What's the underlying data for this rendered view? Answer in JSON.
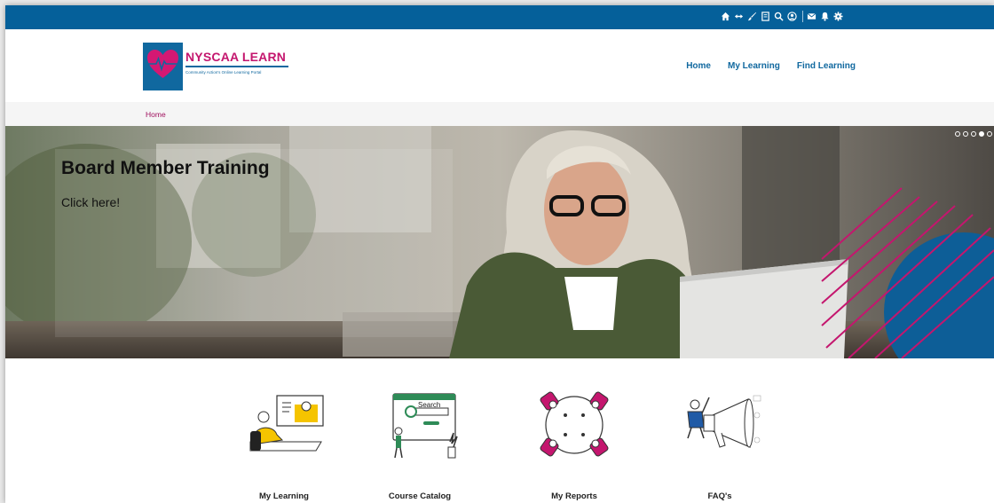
{
  "topbar": {
    "icons": [
      "home-icon",
      "expand-arrows-icon",
      "brush-icon",
      "book-icon",
      "search-icon",
      "user-circle-icon",
      "envelope-icon",
      "bell-icon",
      "gear-icon"
    ]
  },
  "logo": {
    "title": "NYSCAA LEARN",
    "subtitle": "Community Action's Online Learning Portal"
  },
  "nav": {
    "items": [
      "Home",
      "My Learning",
      "Find Learning"
    ]
  },
  "breadcrumb": {
    "home": "Home"
  },
  "hero": {
    "title": "Board Member Training",
    "link": "Click here!",
    "slides": 5,
    "active_slide": 4
  },
  "tiles": [
    {
      "label": "My Learning",
      "icon": "online-learning-illustration"
    },
    {
      "label": "Course Catalog",
      "icon": "search-catalog-illustration"
    },
    {
      "label": "My Reports",
      "icon": "meeting-reports-illustration"
    },
    {
      "label": "FAQ's",
      "icon": "megaphone-faq-illustration"
    }
  ],
  "colors": {
    "brand_blue": "#05609a",
    "brand_magenta": "#c4166e",
    "breadcrumb": "#a0105e"
  }
}
